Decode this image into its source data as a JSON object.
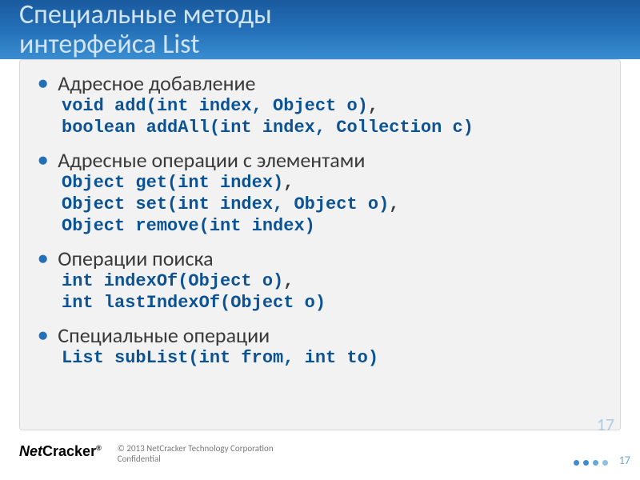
{
  "title_l1": "Специальные методы",
  "title_l2": "интерфейса List",
  "sections": [
    {
      "h": "Адресное добавление",
      "c": [
        "void add(int index, Object o)|,",
        "boolean addAll(int index, Collection c)"
      ]
    },
    {
      "h": "Адресные операции с элементами",
      "c": [
        "Object get(int index)|,",
        "Object set(int index, Object o)|,",
        "Object remove(int index)"
      ]
    },
    {
      "h": "Операции поиска",
      "c": [
        "int indexOf(Object o)|,",
        "int lastIndexOf(Object o)"
      ]
    },
    {
      "h": "Специальные операции",
      "c": [
        "List subList(int from, int to)"
      ]
    }
  ],
  "logo_a": "Net",
  "logo_b": "Cracker",
  "logo_sup": "®",
  "copy_l1": "© 2013 NetCracker Technology Corporation",
  "copy_l2": "Confidential",
  "page_overlay": "17",
  "page": "17"
}
